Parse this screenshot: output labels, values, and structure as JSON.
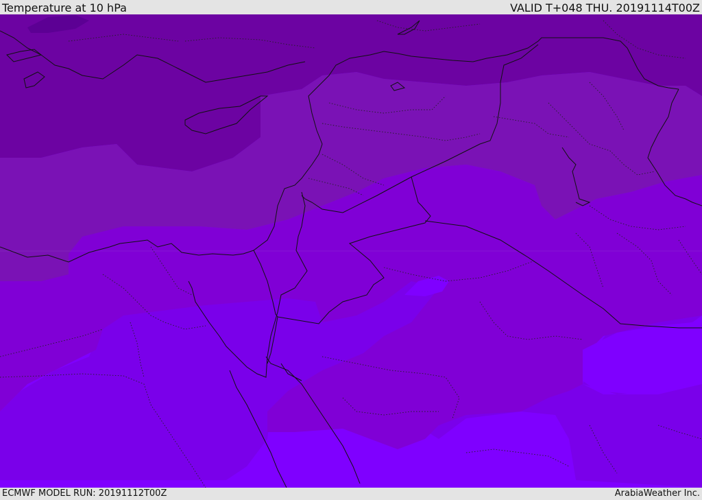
{
  "header": {
    "title": "Temperature at 10 hPa",
    "valid": "VALID T+048 THU. 20191114T00Z"
  },
  "footer": {
    "model_run": "ECMWF MODEL RUN: 20191112T00Z",
    "credit": "ArabiaWeather Inc."
  },
  "colors": {
    "band_darkest": "#5c0094",
    "band_dark": "#6c03a2",
    "band_mid": "#7a12b5",
    "band_light": "#8000d6",
    "band_lighter": "#7a00ea",
    "band_brightest": "#7f00ff",
    "boundary": "#111111"
  }
}
